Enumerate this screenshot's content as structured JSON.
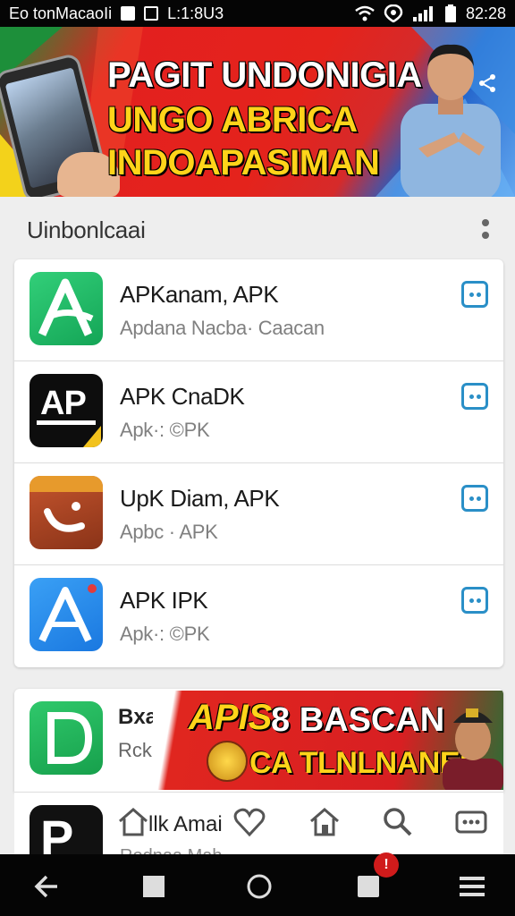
{
  "status_bar": {
    "carrier": "Eo tonMacaoIi",
    "time_left": "L:1:8U3",
    "time_right": "82:28"
  },
  "banner": {
    "line1": "PAGIT UNDONIGIA",
    "line2": "UNGO  ABRICA",
    "line3": "INDOAPASIMAN",
    "colors": {
      "red": "#e3201f",
      "yellow": "#ffd41a",
      "blue": "#1e5fc8"
    }
  },
  "section": {
    "title": "Uinbonlcaai"
  },
  "apps": [
    {
      "name": "APKanam, APK",
      "sub": "Apdana Nacba· Caacan",
      "icon": "green-a-icon",
      "icon_text": ""
    },
    {
      "name": "APK CnaDK",
      "sub": "Apk·: ©PK",
      "icon": "black-ap-icon",
      "icon_text": "AP"
    },
    {
      "name": "UpK Diam, APK",
      "sub": "Apbc · APK",
      "icon": "brown-phone-icon",
      "icon_text": ""
    },
    {
      "name": "APK IPK",
      "sub": "Apk·: ©PK",
      "icon": "blue-a-icon",
      "icon_text": ""
    }
  ],
  "promo": {
    "small1": "Bxa",
    "small2": "Rck",
    "apis": "APIS",
    "text1": "8 BASCAN",
    "text2": "CA TLNLNANES"
  },
  "partial_row": {
    "icon_text": "P",
    "name": "llk Amai",
    "sub": "Rodnaa Mab"
  }
}
